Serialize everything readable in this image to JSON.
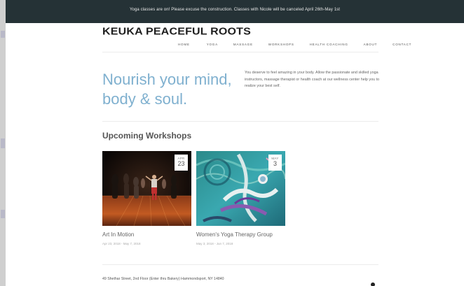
{
  "announcement": "Yoga classes are on! Please excuse the construction. Classes with Nicole will be canceled April 26th-May 1st",
  "brand": "KEUKA PEACEFUL ROOTS",
  "nav": [
    "HOME",
    "YOGA",
    "MASSAGE",
    "WORKSHOPS",
    "HEALTH COACHING",
    "ABOUT",
    "CONTACT"
  ],
  "hero": {
    "title": "Nourish your mind, body & soul.",
    "text": "You deserve to feel amazing in your body. Allow the passionate and skilled yoga instructors, massage therapist or health coach at our wellness center help you to realize your best self."
  },
  "workshops": {
    "heading": "Upcoming Workshops",
    "items": [
      {
        "month": "APR",
        "day": "23",
        "title": "Art In Motion",
        "dates": "Apr 23, 2018 - May 7, 2018"
      },
      {
        "month": "MAY",
        "day": "3",
        "title": "Women's Yoga Therapy Group",
        "dates": "May 3, 2018 - Jun 7, 2018"
      }
    ]
  },
  "footer": {
    "address": "49 Shethar Street, 2nd Floor (Enter thru Bakery) Hammondsport, NY 14840"
  },
  "colors": {
    "topbar": "#253236",
    "accent": "#7fb0cf"
  }
}
